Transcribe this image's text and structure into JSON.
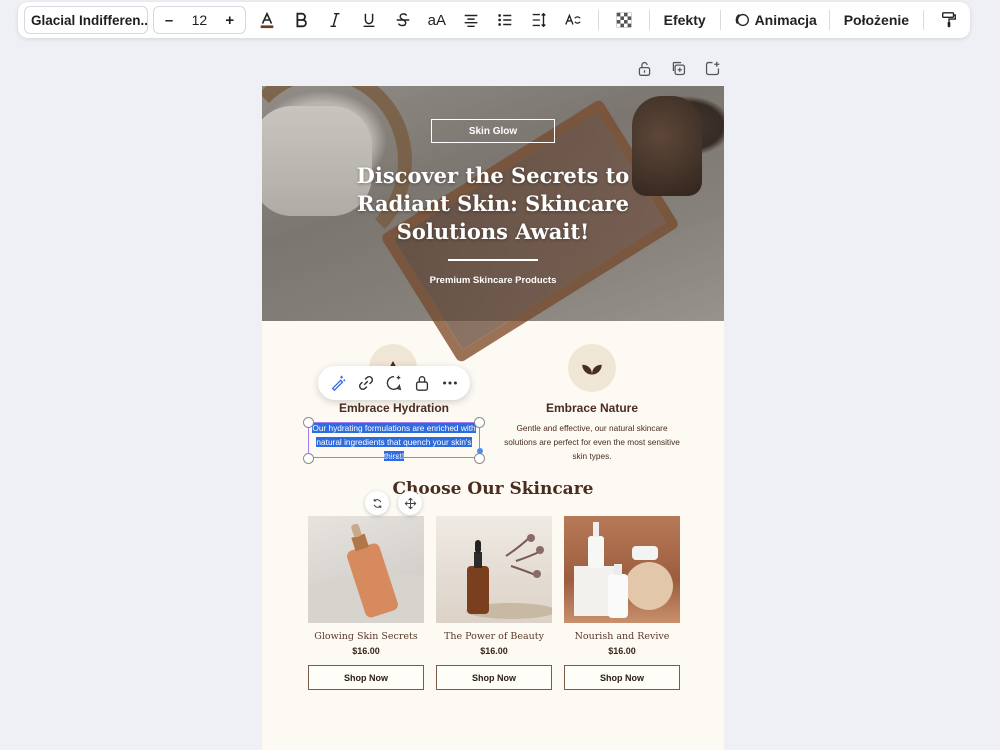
{
  "toolbar": {
    "font_name": "Glacial Indifferen...",
    "font_size": "12",
    "decrease": "–",
    "increase": "+",
    "case_label": "aA",
    "effects_label": "Efekty",
    "animate_label": "Animacja",
    "position_label": "Położenie"
  },
  "hero": {
    "badge": "Skin Glow",
    "title": "Discover the Secrets to Radiant Skin: Skincare Solutions Await!",
    "subtitle": "Premium Skincare Products"
  },
  "features": [
    {
      "title": "Embrace Hydration",
      "text": "Our hydrating formulations are enriched with natural ingredients that quench your skin's thirst!",
      "icon": "drop-icon"
    },
    {
      "title": "Embrace Nature",
      "text": "Gentle and effective, our natural skincare solutions are perfect for even the most sensitive skin types.",
      "icon": "leaf-icon"
    }
  ],
  "section_title": "Choose Our Skincare",
  "products": [
    {
      "name": "Glowing Skin Secrets",
      "price": "$16.00",
      "button": "Shop Now"
    },
    {
      "name": "The Power of Beauty",
      "price": "$16.00",
      "button": "Shop Now"
    },
    {
      "name": "Nourish and Revive",
      "price": "$16.00",
      "button": "Shop Now"
    }
  ],
  "colors": {
    "accent_brown": "#4a2c20",
    "selection_blue": "#2e6bde",
    "canvas_bg": "#fdfaf3",
    "app_bg": "#eef0f5"
  }
}
